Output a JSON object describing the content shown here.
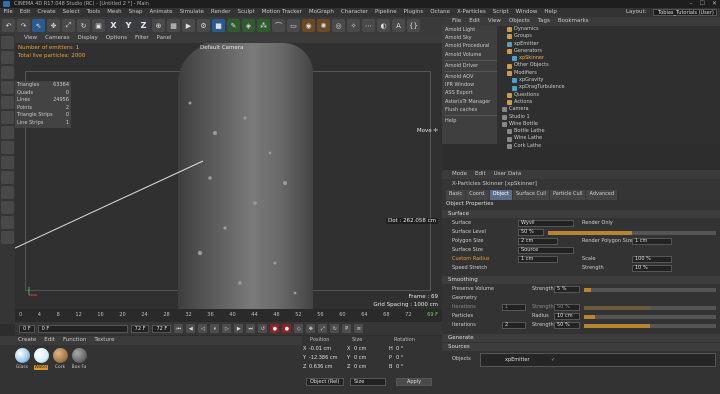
{
  "title": {
    "text": "CINEMA 4D R17.048 Studio (RC) - [Untitled 2 *] - Main"
  },
  "menu": {
    "items": [
      "File",
      "Edit",
      "Create",
      "Select",
      "Tools",
      "Mesh",
      "Snap",
      "Animate",
      "Simulate",
      "Render",
      "Sculpt",
      "Motion Tracker",
      "MoGraph",
      "Character",
      "Pipeline",
      "Plugins",
      "Octane",
      "X-Particles",
      "Script",
      "Window",
      "Help"
    ],
    "layout_label": "Layout:",
    "layout_value": "Tobias_Tutorials (User)"
  },
  "toolbar": {
    "x": "X",
    "y": "Y",
    "z": "Z"
  },
  "viewport": {
    "menu": [
      "View",
      "Cameras",
      "Display",
      "Options",
      "Filter",
      "Panel"
    ],
    "camera": "Default Camera",
    "emitters": [
      "Number of emitters: 1",
      "Total live particles: 2000"
    ],
    "stats": [
      [
        "Triangles",
        "63364"
      ],
      [
        "Quads",
        "0"
      ],
      [
        "Lines",
        "24956"
      ],
      [
        "Points",
        "2"
      ],
      [
        "Triangle Strips",
        "0"
      ],
      [
        "Line Strips",
        "1"
      ]
    ],
    "move": "Move",
    "dot": "Dot : 262.058 cm",
    "frame": "Frame : 69",
    "grid": "Grid Spacing : 1000 cm"
  },
  "timeline": {
    "ticks": [
      "0",
      "4",
      "8",
      "12",
      "16",
      "20",
      "24",
      "28",
      "32",
      "36",
      "40",
      "44",
      "48",
      "52",
      "56",
      "60",
      "64",
      "68",
      "72",
      "69 F"
    ]
  },
  "playbar": {
    "start": "0 F",
    "cur": "0 F",
    "end": "72 F",
    "end2": "72 F"
  },
  "materials": {
    "menu": [
      "Create",
      "Edit",
      "Function",
      "Texture"
    ],
    "items": [
      {
        "name": "Glass",
        "color": "#9acbe8"
      },
      {
        "name": "Water",
        "color": "#d8eef8"
      },
      {
        "name": "Cork",
        "color": "#a47a48"
      },
      {
        "name": "Box Fa",
        "color": "#6a6a6a"
      }
    ]
  },
  "coords": {
    "headers": [
      "Position",
      "Size",
      "Rotation"
    ],
    "rows": [
      [
        "X",
        "-0.01 cm",
        "X",
        "0 cm",
        "H",
        "0 °"
      ],
      [
        "Y",
        "-12.386 cm",
        "Y",
        "0 cm",
        "P",
        "0 °"
      ],
      [
        "Z",
        "0.636 cm",
        "Z",
        "0 cm",
        "B",
        "0 °"
      ]
    ],
    "mode": "Object (Rel)",
    "size": "Size",
    "apply": "Apply"
  },
  "objects": {
    "menu": [
      "File",
      "Edit",
      "View",
      "Objects",
      "Tags",
      "Bookmarks"
    ],
    "dropdown": [
      "Arnold Light",
      "Arnold Sky",
      "Arnold Procedural",
      "Arnold Volume",
      "Arnold Driver",
      "Arnold AOV",
      "IPR Window",
      "ASS Export",
      "AsterixTr Manager",
      "Flush caches",
      "Help"
    ],
    "list": [
      {
        "name": "Dynamics",
        "type": "o",
        "lvl": 2
      },
      {
        "name": "Groups",
        "type": "o",
        "lvl": 2
      },
      {
        "name": "xpEmitter",
        "type": "c",
        "lvl": 2
      },
      {
        "name": "Generators",
        "type": "o",
        "lvl": 2
      },
      {
        "name": "xpSkinner",
        "type": "c",
        "lvl": 3
      },
      {
        "name": "Other Objects",
        "type": "o",
        "lvl": 2
      },
      {
        "name": "Modifiers",
        "type": "o",
        "lvl": 2
      },
      {
        "name": "xpGravity",
        "type": "c",
        "lvl": 3
      },
      {
        "name": "xpDragTurbulence",
        "type": "c",
        "lvl": 3
      },
      {
        "name": "Questions",
        "type": "o",
        "lvl": 2
      },
      {
        "name": "Actions",
        "type": "o",
        "lvl": 2
      },
      {
        "name": "Camera",
        "type": "g",
        "lvl": 1
      },
      {
        "name": "Studio 1",
        "type": "g",
        "lvl": 1
      },
      {
        "name": "Wine Bottle",
        "type": "g",
        "lvl": 1
      },
      {
        "name": "Bottle Lathe",
        "type": "g",
        "lvl": 2
      },
      {
        "name": "Wine Lathe",
        "type": "g",
        "lvl": 2
      },
      {
        "name": "Cork Lathe",
        "type": "g",
        "lvl": 2
      }
    ]
  },
  "attributes": {
    "menu": [
      "Mode",
      "Edit",
      "User Data"
    ],
    "header": "X-Particles Skinner [xpSkinner]",
    "tabs": [
      "Basic",
      "Coord.",
      "Object",
      "Surface Cull",
      "Particle Cull",
      "Advanced"
    ],
    "active_tab": "Object",
    "object_props": "Object Properties",
    "sections": [
      "Surface",
      "Smoothing",
      "Generate",
      "Sources"
    ],
    "props": {
      "surface": "Surface",
      "surface_v": "Wyvil",
      "render_only": "Render Only",
      "surface_level": "Surface Level",
      "surface_level_v": "50 %",
      "polygon_size": "Polygon Size",
      "polygon_size_v": "2 cm",
      "render_polygon": "Render Polygon Size",
      "render_polygon_v": "1 cm",
      "surface_size": "Surface Size",
      "surface_size_v": "Source",
      "custom_radius": "Custom Radius",
      "custom_radius_v": "1 cm",
      "scale": "Scale",
      "scale_v": "100 %",
      "speed_stretch": "Speed Stretch",
      "strength": "Strength",
      "strength_v": "10 %",
      "preserve_volume": "Preserve Volume",
      "pv_strength_v": "5 %",
      "geometry": "Geometry",
      "iterations": "Iterations",
      "iter_v": "1",
      "str2_v": "50 %",
      "particles": "Particles",
      "radius": "Radius",
      "radius_v": "10 cm",
      "iterations2": "Iterations",
      "iter2_v": "2",
      "str3_v": "50 %",
      "objects": "Objects",
      "objects_v": "xpEmitter"
    }
  }
}
